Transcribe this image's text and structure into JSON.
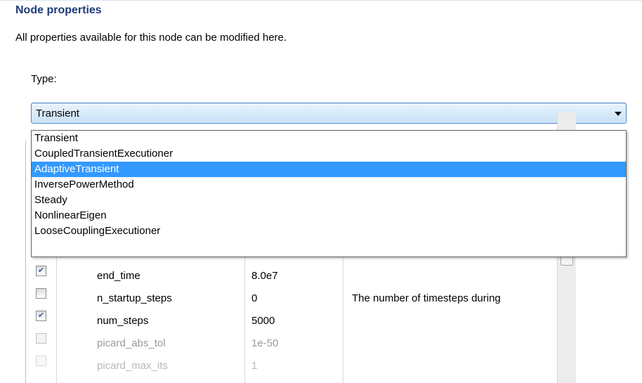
{
  "section": {
    "title": "Node properties",
    "description": "All properties available for this node can be modified here."
  },
  "type_field": {
    "label": "Type:",
    "value": "Transient",
    "options": [
      "Transient",
      "CoupledTransientExecutioner",
      "AdaptiveTransient",
      "InversePowerMethod",
      "Steady",
      "NonlinearEigen",
      "LooseCouplingExecutioner"
    ],
    "highlighted_option": "AdaptiveTransient"
  },
  "table": {
    "rows": [
      {
        "checked": true,
        "name": "end_time",
        "value": "8.0e7",
        "description": ""
      },
      {
        "checked": false,
        "name": "n_startup_steps",
        "value": "0",
        "description": "The number of timesteps during"
      },
      {
        "checked": true,
        "name": "num_steps",
        "value": "5000",
        "description": ""
      },
      {
        "checked": false,
        "name": "picard_abs_tol",
        "value": "1e-50",
        "description": ""
      },
      {
        "checked": false,
        "name": "picard_max_its",
        "value": "1",
        "description": ""
      }
    ]
  },
  "colors": {
    "title": "#1f3b7a",
    "selection": "#3399ff"
  },
  "icons": {
    "dropdown_arrow": "chevron-down-icon",
    "checkbox_check": "check-icon"
  }
}
